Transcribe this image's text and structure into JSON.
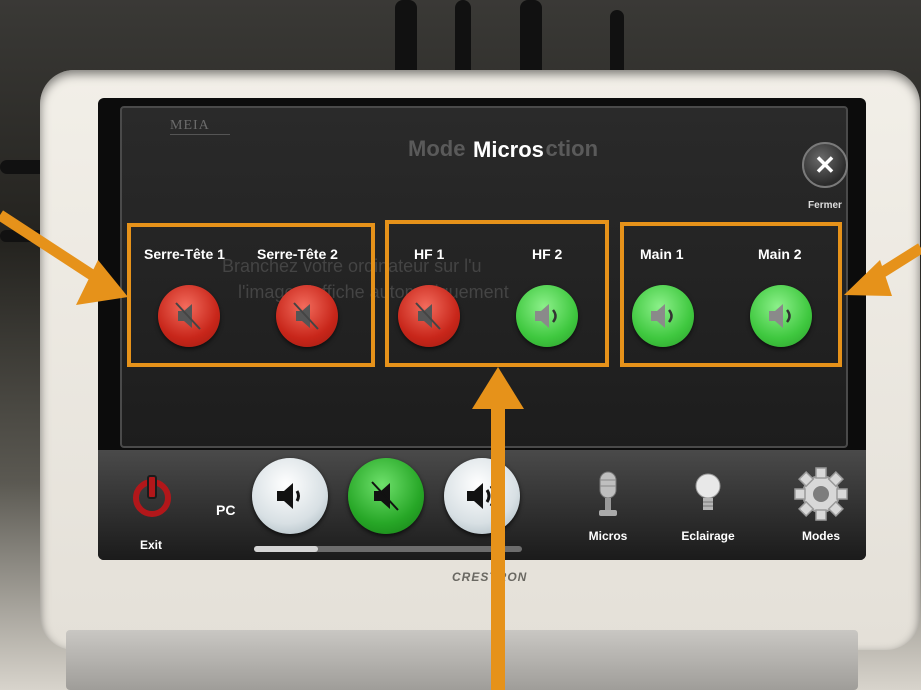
{
  "screen": {
    "logo_text": "MEIA",
    "ghost_title": "Mode",
    "ghost_title_tail": "ction",
    "title": "Micros",
    "ghost_line1": "Branchez votre ordinateur sur l'u",
    "ghost_line2": "l'image s'affiche automatiquement",
    "close_label": "Fermer",
    "groups": [
      {
        "name": "serre-tete",
        "mics": [
          {
            "label": "Serre-Tête 1",
            "state": "muted",
            "color": "#c8261a"
          },
          {
            "label": "Serre-Tête 2",
            "state": "muted",
            "color": "#c8261a"
          }
        ]
      },
      {
        "name": "hf",
        "mics": [
          {
            "label": "HF 1",
            "state": "muted",
            "color": "#c8261a"
          },
          {
            "label": "HF 2",
            "state": "on",
            "color": "#3fc83f"
          }
        ]
      },
      {
        "name": "main",
        "mics": [
          {
            "label": "Main 1",
            "state": "on",
            "color": "#3fc83f"
          },
          {
            "label": "Main 2",
            "state": "on",
            "color": "#3fc83f"
          }
        ]
      }
    ]
  },
  "bottom_bar": {
    "exit_label": "Exit",
    "pc_label": "PC",
    "volume_level_fraction": 0.24,
    "buttons": [
      {
        "name": "volume-down",
        "icon": "speaker-icon"
      },
      {
        "name": "mute",
        "icon": "speaker-muted-icon"
      },
      {
        "name": "volume-up",
        "icon": "speaker-loud-icon"
      }
    ],
    "nav": [
      {
        "label": "Micros",
        "icon": "microphone-icon"
      },
      {
        "label": "Eclairage",
        "icon": "lightbulb-icon"
      },
      {
        "label": "Modes",
        "icon": "gear-icon"
      }
    ]
  },
  "device": {
    "brand": "CRESTRON"
  },
  "colors": {
    "highlight": "#e6921a",
    "muted_red": "#c8261a",
    "active_green": "#3fc83f"
  }
}
